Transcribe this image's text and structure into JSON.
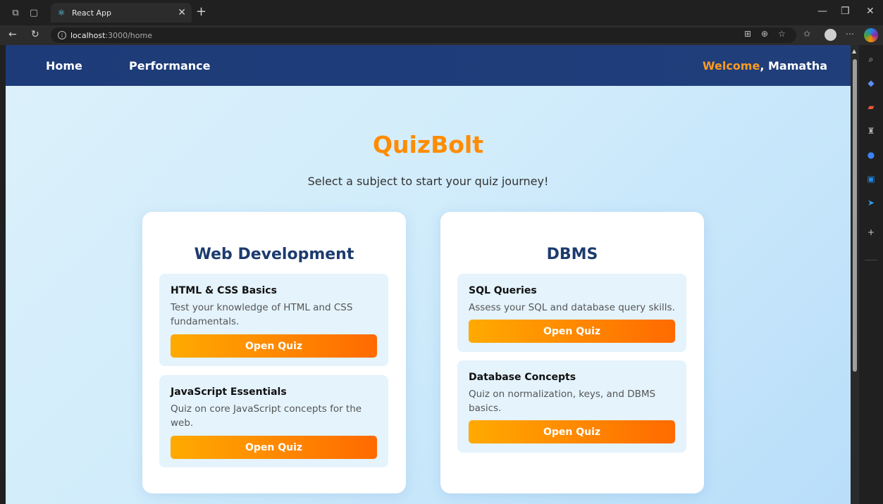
{
  "browser": {
    "tab_title": "React App",
    "url_host": "localhost",
    "url_path": ":3000/home"
  },
  "nav": {
    "home": "Home",
    "performance": "Performance",
    "welcome_word": "Welcome",
    "welcome_rest": ", Mamatha"
  },
  "hero": {
    "title": "QuizBolt",
    "subtitle": "Select a subject to start your quiz journey!"
  },
  "subjects": [
    {
      "title": "Web Development",
      "quizzes": [
        {
          "name": "HTML & CSS Basics",
          "description": "Test your knowledge of HTML and CSS fundamentals.",
          "button": "Open Quiz"
        },
        {
          "name": "JavaScript Essentials",
          "description": "Quiz on core JavaScript concepts for the web.",
          "button": "Open Quiz"
        }
      ]
    },
    {
      "title": "DBMS",
      "quizzes": [
        {
          "name": "SQL Queries",
          "description": "Assess your SQL and database query skills.",
          "button": "Open Quiz"
        },
        {
          "name": "Database Concepts",
          "description": "Quiz on normalization, keys, and DBMS basics.",
          "button": "Open Quiz"
        }
      ]
    }
  ],
  "colors": {
    "accent": "#ff8c00",
    "nav_bg": "#1d3b78",
    "card_title": "#1d3b6e",
    "quiz_bg": "#e4f3fc"
  }
}
